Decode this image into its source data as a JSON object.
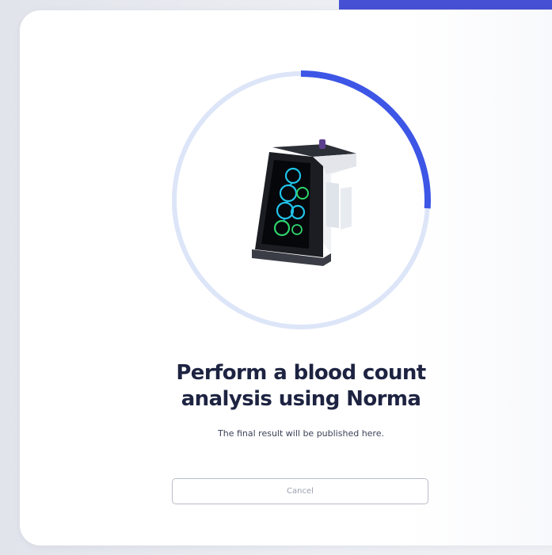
{
  "header": {
    "accent_color": "#4650d4"
  },
  "progress": {
    "value": 0.26,
    "track_color": "#dde5f8",
    "fill_color": "#3d56e6"
  },
  "device": {
    "icon": "blood-analyzer-device-icon"
  },
  "content": {
    "title_line1": "Perform a blood count",
    "title_line2": "analysis using Norma",
    "subtitle": "The final result will be published here."
  },
  "actions": {
    "cancel_label": "Cancel"
  }
}
